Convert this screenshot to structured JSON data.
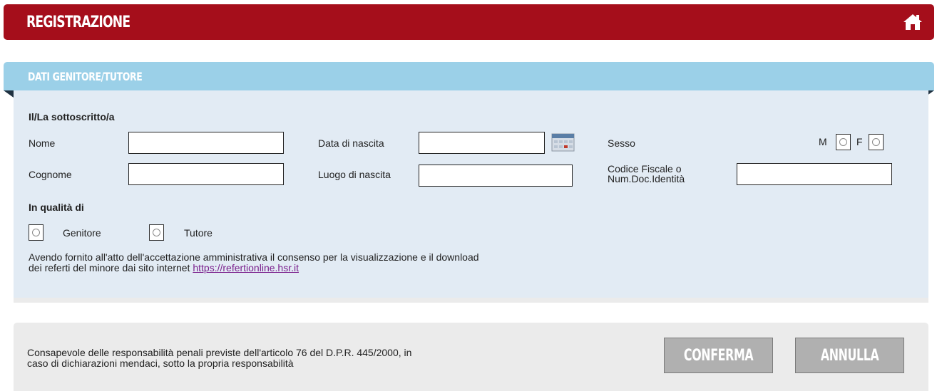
{
  "header": {
    "title": "REGISTRAZIONE",
    "home_icon": "home-icon"
  },
  "section": {
    "title": "DATI GENITORE/TUTORE"
  },
  "form": {
    "subscriber_heading": "Il/La sottoscritto/a",
    "nome": {
      "label": "Nome",
      "value": ""
    },
    "cognome": {
      "label": "Cognome",
      "value": ""
    },
    "data_nascita": {
      "label": "Data di nascita",
      "value": "",
      "icon": "calendar-icon"
    },
    "luogo_nascita": {
      "label": "Luogo di nascita",
      "value": ""
    },
    "sesso": {
      "label": "Sesso",
      "option_m": "M",
      "option_f": "F"
    },
    "codice_fiscale": {
      "label_line1": "Codice Fiscale o",
      "label_line2": "Num.Doc.Identità",
      "value": ""
    },
    "qualita_heading": "In qualità di",
    "genitore_label": "Genitore",
    "tutore_label": "Tutore",
    "consent_line1": "Avendo fornito all'atto dell'accettazione amministrativa il consenso per la visualizzazione e il download",
    "consent_line2_prefix": "dei referti del minore dai sito internet ",
    "consent_link": "https://refertionline.hsr.it"
  },
  "footer": {
    "disclaimer_line1": "Consapevole delle responsabilità penali previste dell'articolo 76 del D.P.R. 445/2000, in",
    "disclaimer_line2": "caso di dichiarazioni mendaci, sotto la propria responsabilità",
    "confirm_label": "CONFERMA",
    "cancel_label": "ANNULLA"
  },
  "colors": {
    "header_bg": "#a50e1b",
    "section_bg": "#9bd0e8",
    "panel_bg": "#e2ebf4",
    "footer_bg": "#ebebeb",
    "button_bg": "#b0b0b0",
    "link": "#7a1f8c"
  }
}
